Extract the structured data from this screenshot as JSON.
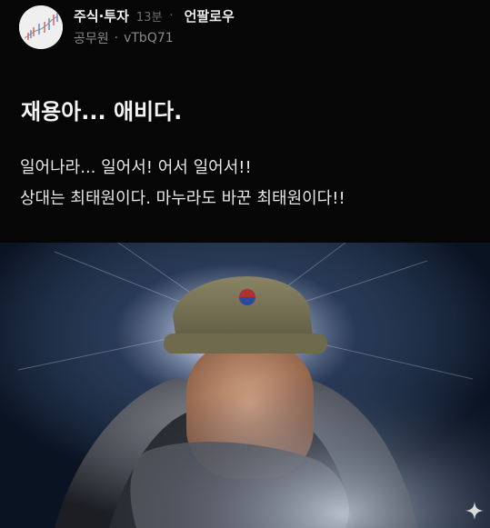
{
  "post": {
    "channel": "주식·투자",
    "time": "13분",
    "separator": "·",
    "follow_label": "언팔로우",
    "author_job": "공무원",
    "author_sep": "·",
    "author_id": "vTbQ71",
    "title": "재용아... 애비다.",
    "body_lines": [
      "일어나라... 일어서! 어서 일어서!!",
      "상대는 최태원이다. 마누라도 바꾼 최태원이다!!"
    ]
  },
  "icons": {
    "avatar": "stock-chart-avatar-icon",
    "sparkle": "sparkle-icon"
  },
  "colors": {
    "background": "#060606",
    "text": "#e6e6e6",
    "muted": "#8a8a8a"
  }
}
